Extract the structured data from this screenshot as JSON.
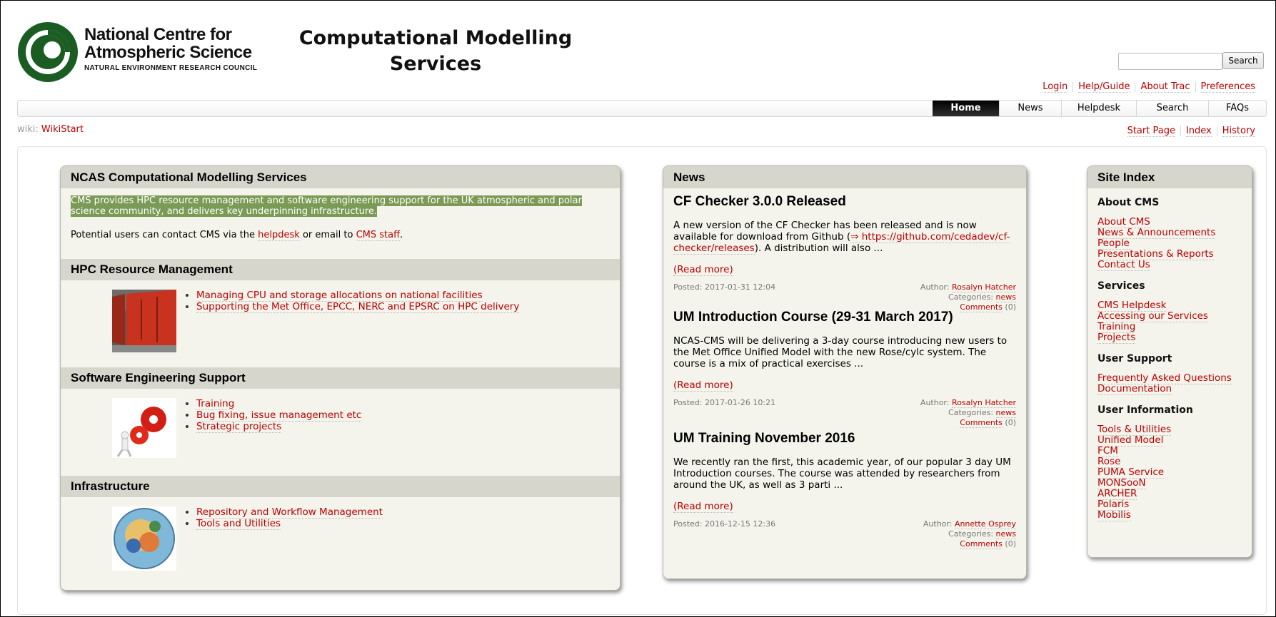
{
  "header": {
    "org_line1": "National Centre for",
    "org_line2": "Atmospheric Science",
    "org_line3": "NATURAL ENVIRONMENT RESEARCH COUNCIL",
    "site_title": "Computational Modelling Services",
    "search_button": "Search",
    "brand_color": "#1a5c22"
  },
  "metanav": [
    "Login",
    "Help/Guide",
    "About Trac",
    "Preferences"
  ],
  "mainnav": {
    "tabs": [
      "Home",
      "News",
      "Helpdesk",
      "Search",
      "FAQs"
    ],
    "active": "Home"
  },
  "context": {
    "prefix": "wiki:",
    "page": "WikiStart",
    "nav": [
      "Start Page",
      "Index",
      "History"
    ]
  },
  "main": {
    "title": "NCAS Computational Modelling Services",
    "intro": "CMS provides HPC resource management and software engineering support for the UK atmospheric and polar science community, and delivers key underpinning infrastructure.",
    "contact_pre": "Potential users can contact CMS via the ",
    "contact_link1": "helpdesk",
    "contact_mid": " or email to ",
    "contact_link2": "CMS staff",
    "contact_post": ".",
    "sections": [
      {
        "title": "HPC Resource Management",
        "items": [
          "Managing CPU and storage allocations on national facilities",
          "Supporting the Met Office, EPCC, NERC and EPSRC on HPC delivery"
        ]
      },
      {
        "title": "Software Engineering Support",
        "items": [
          "Training",
          "Bug fixing, issue management etc",
          "Strategic projects"
        ]
      },
      {
        "title": "Infrastructure",
        "items": [
          "Repository and Workflow Management",
          "Tools and Utilities"
        ]
      }
    ]
  },
  "news": {
    "title": "News",
    "posts": [
      {
        "title": "CF Checker 3.0.0 Released",
        "body_pre": "A new version of the CF Checker has been released and is now available for download from Github (",
        "link": "https://github.com/cedadev/cf-checker/releases",
        "body_post": "). A distribution will also ...",
        "read_more": "(Read more)",
        "posted": "Posted: 2017-01-31 12:04",
        "author_label": "Author:",
        "author": "Rosalyn Hatcher",
        "categories_label": "Categories:",
        "category": "news",
        "comments": "Comments",
        "comment_count": "(0)"
      },
      {
        "title": "UM Introduction Course (29-31 March 2017)",
        "body_pre": "NCAS-CMS will be delivering a 3-day course introducing new users to the Met Office Unified Model with the new Rose/cylc system. The course is a mix of practical exercises ...",
        "read_more": "(Read more)",
        "posted": "Posted: 2017-01-26 10:21",
        "author_label": "Author:",
        "author": "Rosalyn Hatcher",
        "categories_label": "Categories:",
        "category": "news",
        "comments": "Comments",
        "comment_count": "(0)"
      },
      {
        "title": "UM Training November 2016",
        "body_pre": "We recently ran the first, this academic year, of our popular 3 day UM Introduction courses. The course was attended by researchers from around the UK, as well as 3 parti ...",
        "read_more": "(Read more)",
        "posted": "Posted: 2016-12-15 12:36",
        "author_label": "Author:",
        "author": "Annette Osprey",
        "categories_label": "Categories:",
        "category": "news",
        "comments": "Comments",
        "comment_count": "(0)"
      }
    ]
  },
  "site_index": {
    "title": "Site Index",
    "groups": [
      {
        "heading": "About CMS",
        "links": [
          "About CMS",
          "News & Announcements",
          "People",
          "Presentations & Reports",
          "Contact Us"
        ]
      },
      {
        "heading": "Services",
        "links": [
          "CMS Helpdesk",
          "Accessing our Services",
          "Training",
          "Projects"
        ]
      },
      {
        "heading": "User Support",
        "links": [
          "Frequently Asked Questions",
          "Documentation"
        ]
      },
      {
        "heading": "User Information",
        "links": [
          "Tools & Utilities",
          "Unified Model",
          "FCM",
          "Rose",
          "PUMA Service",
          "MONSooN",
          "ARCHER",
          "Polaris",
          "Mobilis"
        ]
      }
    ]
  }
}
